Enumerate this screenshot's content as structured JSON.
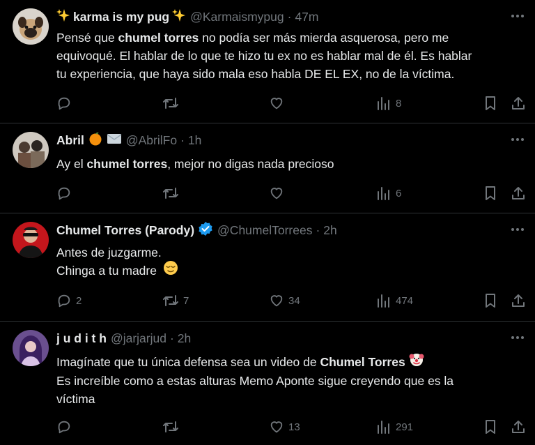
{
  "tweets": [
    {
      "name": "karma is my pug",
      "handle": "@Karmaismypug",
      "time": "47m",
      "lines": [
        [
          "Pensé que ",
          "chumel torres",
          " no podía ser más mierda asquerosa, pero me"
        ],
        [
          "equivoqué. El hablar de lo que te hizo tu ex no es hablar mal de él. Es hablar"
        ],
        [
          "tu experiencia, que haya sido mala eso habla DE EL EX, no de la víctima."
        ]
      ],
      "replies": "",
      "reposts": "",
      "likes": "",
      "views": "8"
    },
    {
      "name": "Abril",
      "handle": "@AbrilFo",
      "time": "1h",
      "lines": [
        [
          "Ay el ",
          "chumel torres",
          ", mejor no digas nada precioso"
        ]
      ],
      "replies": "",
      "reposts": "",
      "likes": "",
      "views": "6"
    },
    {
      "name": "Chumel Torres (Parody)",
      "handle": "@ChumelTorrees",
      "time": "2h",
      "lines": [
        [
          "Antes de juzgarme."
        ],
        [
          "Chinga a tu madre"
        ]
      ],
      "replies": "2",
      "reposts": "7",
      "likes": "34",
      "views": "474"
    },
    {
      "name": "j u d i t h",
      "handle": "@jarjarjud",
      "time": "2h",
      "lines": [
        [
          "Imagínate que tu única defensa sea un video de ",
          "Chumel Torres",
          ""
        ],
        [
          "Es increíble como a estas alturas Memo Aponte sigue creyendo que es la"
        ],
        [
          "víctima"
        ]
      ],
      "replies": "",
      "reposts": "",
      "likes": "13",
      "views": "291"
    }
  ],
  "icons": {
    "more": "more-icon",
    "reply": "reply-icon",
    "repost": "repost-icon",
    "like": "like-icon",
    "views": "views-icon",
    "bookmark": "bookmark-icon",
    "share": "share-icon",
    "sparkles": "sparkles-emoji",
    "orange": "orange-emoji",
    "envelope": "envelope-emoji",
    "verified": "verified-badge-icon",
    "relieved": "relieved-face-emoji",
    "clown": "clown-face-emoji"
  },
  "colors": {
    "background": "#000000",
    "text": "#e7e9ea",
    "muted": "#71767b",
    "divider": "#2f3336",
    "verified": "#1d9bf0"
  }
}
